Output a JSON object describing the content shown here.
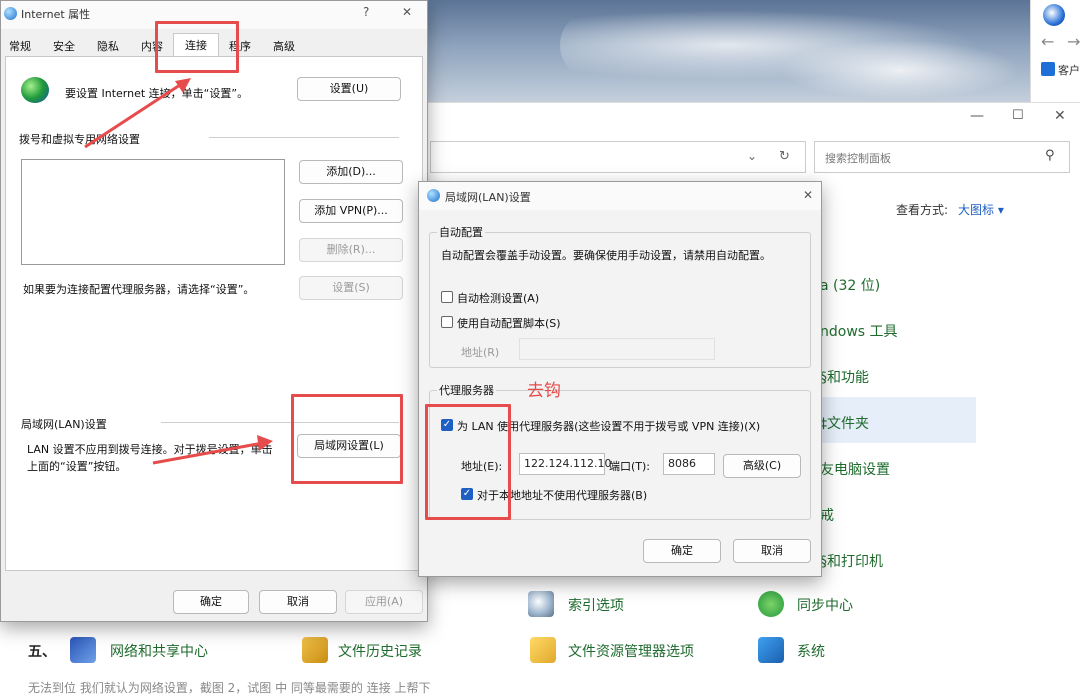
{
  "desktop": {
    "background": "sky"
  },
  "browser": {
    "client_label": "客户",
    "back_arrow": "←",
    "fwd_arrow": "→"
  },
  "control_panel": {
    "search_placeholder": "搜索控制面板",
    "view_by_label": "查看方式:",
    "view_by_value": "大图标 ▾",
    "items_partial": [
      "a (32 位)",
      "ndows 工具",
      "§和功能",
      "‡文件夹",
      "友电脑设置",
      "戒",
      "§和打印机"
    ],
    "items_row1": [
      {
        "label": "索引选项",
        "icon": "magnifier-icon"
      },
      {
        "label": "同步中心",
        "icon": "sync-icon"
      }
    ],
    "items_row2": [
      {
        "label": "网络和共享中心",
        "icon": "network-icon"
      },
      {
        "label": "文件历史记录",
        "icon": "file-history-icon"
      },
      {
        "label": "文件资源管理器选项",
        "icon": "folder-options-icon"
      },
      {
        "label": "系统",
        "icon": "system-icon"
      }
    ],
    "bottom_left_char": "五、"
  },
  "internet_dialog": {
    "title": "Internet 属性",
    "help": "?",
    "close": "✕",
    "tabs": [
      "常规",
      "安全",
      "隐私",
      "内容",
      "连接",
      "程序",
      "高级"
    ],
    "setup_text": "要设置 Internet 连接，单击“设置”。",
    "setup_btn": "设置(U)",
    "dialup_section": "拨号和虚拟专用网络设置",
    "add_btn": "添加(D)...",
    "add_vpn_btn": "添加 VPN(P)...",
    "remove_btn": "删除(R)...",
    "proxy_hint": "如果要为连接配置代理服务器，请选择“设置”。",
    "settings_btn": "设置(S)",
    "lan_section": "局域网(LAN)设置",
    "lan_text_1": "LAN 设置不应用到拨号连接。对于拨号设置，单击",
    "lan_text_2": "上面的“设置”按钮。",
    "lan_btn": "局域网设置(L)",
    "ok": "确定",
    "cancel": "取消",
    "apply": "应用(A)"
  },
  "lan_dialog": {
    "title": "局域网(LAN)设置",
    "close": "✕",
    "auto_section": "自动配置",
    "auto_desc": "自动配置会覆盖手动设置。要确保使用手动设置，请禁用自动配置。",
    "auto_detect": "自动检测设置(A)",
    "auto_script": "使用自动配置脚本(S)",
    "address_label_disabled": "地址(R)",
    "proxy_section": "代理服务器",
    "annotation": "去钩",
    "use_proxy": "为 LAN 使用代理服务器(这些设置不用于拨号或 VPN 连接)(X)",
    "address_label": "地址(E):",
    "address_value": "122.124.112.10",
    "port_label": "端口(T):",
    "port_value": "8086",
    "advanced_btn": "高级(C)",
    "bypass_local": "对于本地地址不使用代理服务器(B)",
    "ok": "确定",
    "cancel": "取消"
  },
  "bottom_text": "无法到位 我们就认为网络设置，截图 2，试图 中 同等最需要的 连接 上帮下",
  "colors": {
    "annotation_red": "#e74c4c",
    "link_blue": "#1e5fc4",
    "cp_green": "#1f6b2e"
  }
}
